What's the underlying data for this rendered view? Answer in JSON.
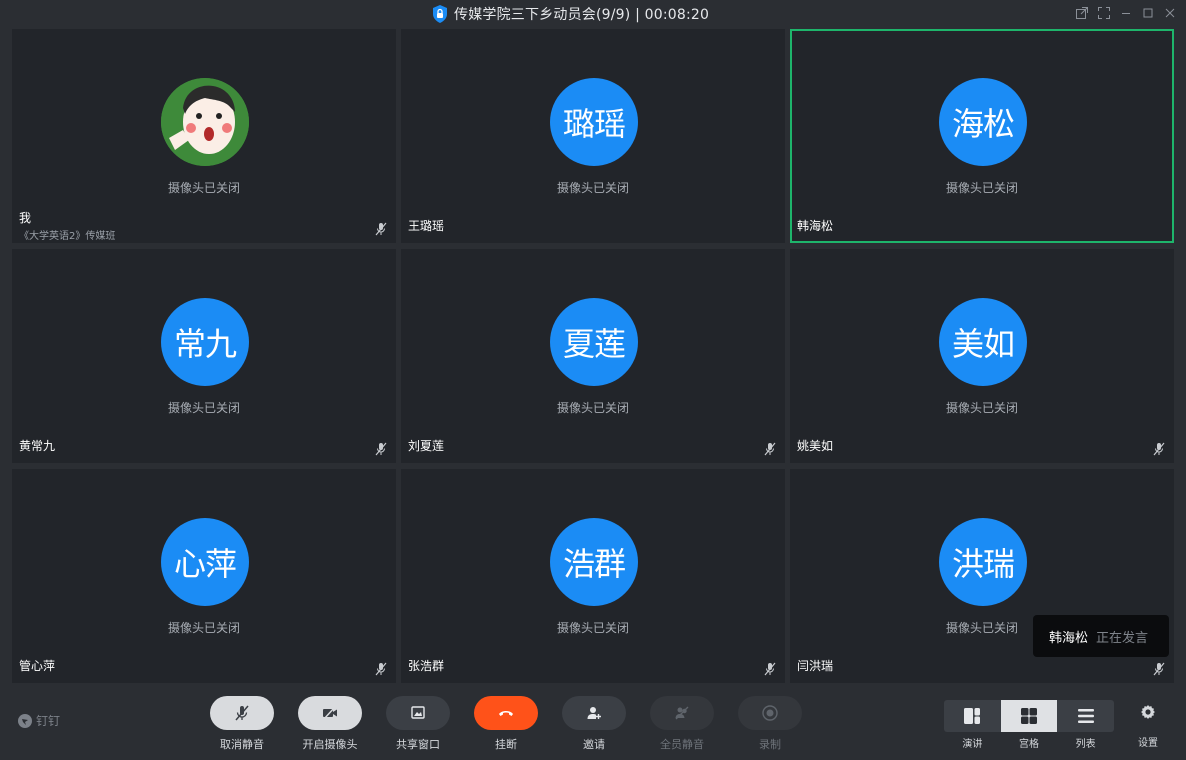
{
  "window": {
    "title": "传媒学院三下乡动员会(9/9) | 00:08:20"
  },
  "camera_off_text": "摄像头已关闭",
  "participants": [
    {
      "avatar_text": "",
      "name": "我",
      "subtitle": "《大学英语2》传媒班",
      "muted": true,
      "photo": true
    },
    {
      "avatar_text": "璐瑶",
      "name": "王璐瑶",
      "muted": false
    },
    {
      "avatar_text": "海松",
      "name": "韩海松",
      "muted": false,
      "active_speaker": true
    },
    {
      "avatar_text": "常九",
      "name": "黄常九",
      "muted": true
    },
    {
      "avatar_text": "夏莲",
      "name": "刘夏莲",
      "muted": true
    },
    {
      "avatar_text": "美如",
      "name": "姚美如",
      "muted": true
    },
    {
      "avatar_text": "心萍",
      "name": "管心萍",
      "muted": true
    },
    {
      "avatar_text": "浩群",
      "name": "张浩群",
      "muted": true
    },
    {
      "avatar_text": "洪瑞",
      "name": "闫洪瑞",
      "muted": true
    }
  ],
  "speaking_toast": {
    "name": "韩海松",
    "status": "正在发言"
  },
  "toolbar": {
    "brand": "钉钉",
    "unmute": "取消静音",
    "camera_on": "开启摄像头",
    "share_window": "共享窗口",
    "hang_up": "挂断",
    "invite": "邀请",
    "mute_all": "全员静音",
    "record": "录制",
    "layout_speaker": "演讲",
    "layout_grid": "宫格",
    "layout_list": "列表",
    "settings": "设置"
  },
  "colors": {
    "accent_blue": "#1b8cf5",
    "active_green": "#1eb56b",
    "hangup_red": "#ff5219"
  }
}
